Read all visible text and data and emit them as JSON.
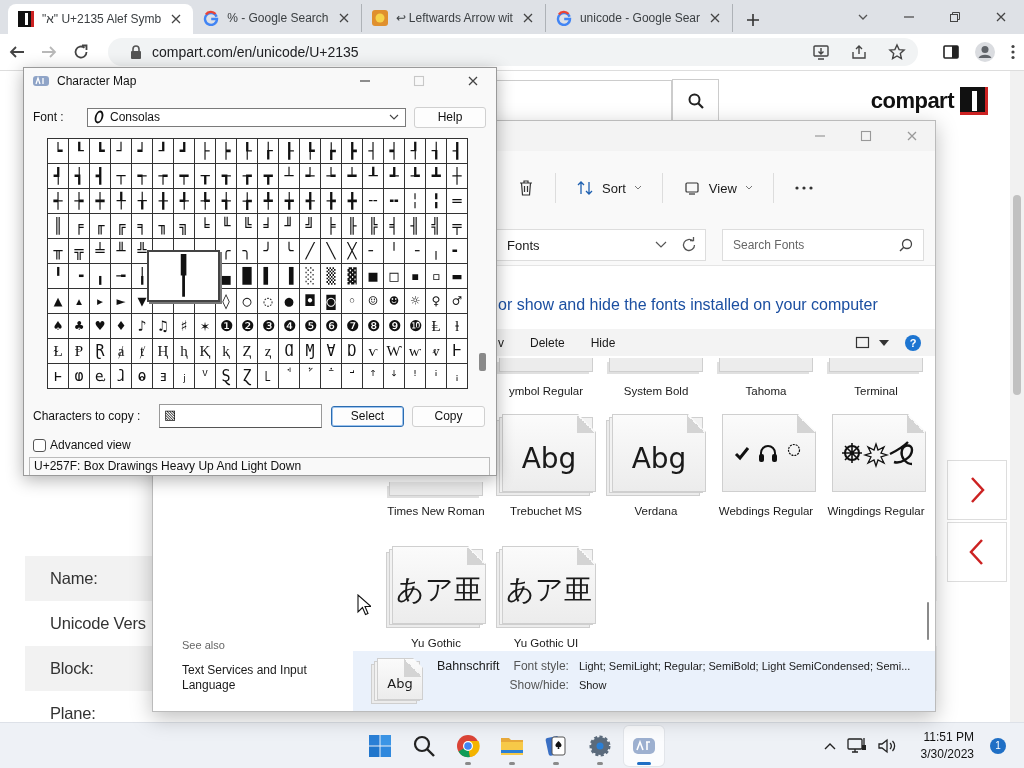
{
  "browser": {
    "tabs": [
      {
        "title": "\"א\" U+2135 Alef Symb",
        "kind": "logo",
        "selected": true
      },
      {
        "title": "% - Google Search",
        "kind": "g",
        "selected": false
      },
      {
        "title": "↩ Leftwards Arrow wit",
        "kind": "emoji",
        "selected": false
      },
      {
        "title": "unicode - Google Sear",
        "kind": "g",
        "selected": false
      }
    ],
    "forward": {
      "disabled": true
    },
    "address": "compart.com/en/unicode/U+2135"
  },
  "page": {
    "logo": "compart",
    "rows": [
      {
        "label": "Name:"
      },
      {
        "label": "Unicode Vers"
      },
      {
        "label": "Block:"
      },
      {
        "label": "Plane:"
      }
    ]
  },
  "charmap": {
    "title": "Character Map",
    "maximize": {
      "disabled": true
    },
    "font_label": "Font :",
    "font": "Consolas",
    "help": "Help",
    "grid": [
      [
        "┕",
        "┖",
        "┗",
        "┘",
        "┙",
        "┚",
        "┛",
        "├",
        "┝",
        "┞",
        "┟",
        "┠",
        "┡",
        "┢",
        "┣",
        "┤",
        "┥",
        "┦",
        "┧",
        "┨"
      ],
      [
        "┩",
        "┪",
        "┫",
        "┬",
        "┭",
        "┮",
        "┯",
        "┰",
        "┱",
        "┲",
        "┳",
        "┴",
        "┵",
        "┶",
        "┷",
        "┸",
        "┹",
        "┺",
        "┻",
        "┼"
      ],
      [
        "┽",
        "┾",
        "┿",
        "╀",
        "╁",
        "╂",
        "╃",
        "╄",
        "╅",
        "╆",
        "╇",
        "╈",
        "╉",
        "╊",
        "╋",
        "╌",
        "╍",
        "╎",
        "╏",
        "═"
      ],
      [
        "║",
        "╒",
        "╓",
        "╔",
        "╕",
        "╖",
        "╗",
        "╘",
        "╙",
        "╚",
        "╛",
        "╜",
        "╝",
        "╞",
        "╟",
        "╠",
        "╡",
        "╢",
        "╣",
        "╤"
      ],
      {
        "left": [
          "╥",
          "╦",
          "╧",
          "╨",
          "╩"
        ],
        "right": [
          "╭",
          "╮",
          "╯",
          "╰",
          "╱",
          "╲",
          "╳",
          "╴",
          "╵",
          "╶",
          "╷",
          "╸"
        ]
      },
      {
        "left": [
          "╹",
          "╺",
          "╻",
          "╼",
          "╽"
        ],
        "right": [
          "▄",
          "█",
          "▌",
          "▐",
          "░",
          "▒",
          "▓",
          "■",
          "□",
          "▪",
          "▫",
          "▬"
        ]
      },
      {
        "left": [
          "▲",
          "▴",
          "▸",
          "►",
          "▼"
        ],
        "right": [
          "◊",
          "○",
          "◌",
          "●",
          "◘",
          "◙",
          "◦",
          "☺",
          "☻",
          "☼",
          "♀",
          "♂"
        ]
      },
      [
        "♠",
        "♣",
        "♥",
        "♦",
        "♪",
        "♫",
        "♯",
        "✶",
        "❶",
        "❷",
        "❸",
        "❹",
        "❺",
        "❻",
        "❼",
        "❽",
        "❾",
        "❿",
        "Ⱡ",
        "ⱡ"
      ],
      [
        "Ɫ",
        "Ᵽ",
        "Ɽ",
        "ⱥ",
        "ⱦ",
        "Ⱨ",
        "ⱨ",
        "Ⱪ",
        "ⱪ",
        "Ⱬ",
        "ⱬ",
        "Ɑ",
        "Ɱ",
        "Ɐ",
        "Ɒ",
        "ⱱ",
        "Ⱳ",
        "ⱳ",
        "ⱴ",
        "Ⱶ"
      ],
      [
        "ⱶ",
        "ⱷ",
        "ⱸ",
        "ⱹ",
        "ⱺ",
        "ⱻ",
        "ⱼ",
        "ⱽ",
        "Ȿ",
        "Ɀ",
        "꜖",
        "ꜗ",
        "ꜘ",
        "ꜙ",
        "ꜚ",
        "ꜛ",
        "ꜜ",
        "ꜝ",
        "ꜞ",
        "ꜟ"
      ]
    ],
    "magnified": "╿",
    "copy_label": "Characters to copy :",
    "copy_value": "▧",
    "buttons": [
      {
        "label": "Select",
        "focused": true
      },
      {
        "label": "Copy",
        "focused": false
      }
    ],
    "advanced": {
      "label": "Advanced view",
      "checked": false
    },
    "status": "U+257F: Box Drawings Heavy Up And Light Down"
  },
  "fonts_window": {
    "toolbar": [
      {
        "kind": "delete"
      },
      {
        "kind": "sort",
        "label": "Sort"
      },
      {
        "kind": "view",
        "label": "View"
      },
      {
        "kind": "more"
      }
    ],
    "location": "Fonts",
    "search_placeholder": "Search Fonts",
    "heading": "or show and hide the fonts installed on your computer",
    "actions": [
      "v",
      "Delete",
      "Hide"
    ],
    "help": "?",
    "tile_rows": [
      [
        {
          "name": "ymbol Regular",
          "kind": "stub",
          "stacked": true
        },
        {
          "name": "System Bold",
          "kind": "stub",
          "stacked": true
        },
        {
          "name": "Tahoma",
          "kind": "stub",
          "stacked": true
        },
        {
          "name": "Terminal",
          "kind": "stub",
          "stacked": true
        }
      ],
      [
        {
          "name": "Times New Roman",
          "kind": "stub",
          "stacked": true
        },
        {
          "name": "Trebuchet MS",
          "kind": "text",
          "preview": "Abg",
          "stacked": true
        },
        {
          "name": "Verdana",
          "kind": "text",
          "preview": "Abg",
          "stacked": true
        },
        {
          "name": "Webdings Regular",
          "kind": "webdings",
          "stacked": false
        },
        {
          "name": "Wingdings Regular",
          "kind": "wingdings",
          "stacked": false
        }
      ],
      [
        {
          "name": "Yu Gothic",
          "kind": "text",
          "preview": "あア亜",
          "stacked": true
        },
        {
          "name": "Yu Gothic UI",
          "kind": "text",
          "preview": "あア亜",
          "stacked": true
        }
      ]
    ],
    "see_also": {
      "title": "See also",
      "links": [
        "Text Services and Input Language"
      ]
    },
    "details": {
      "preview": "Abg",
      "name": "Bahnschrift",
      "fields": [
        {
          "label": "Font style:",
          "value": "Light; SemiLight; Regular; SemiBold; Light SemiCondensed; Semi..."
        },
        {
          "label": "Show/hide:",
          "value": "Show"
        }
      ]
    }
  },
  "taskbar": {
    "apps": [
      {
        "kind": "start",
        "running": false,
        "selected": false
      },
      {
        "kind": "search",
        "running": false,
        "selected": false
      },
      {
        "kind": "browser",
        "running": true,
        "selected": false
      },
      {
        "kind": "files",
        "running": true,
        "selected": false
      },
      {
        "kind": "cards",
        "running": true,
        "selected": false
      },
      {
        "kind": "settings",
        "running": true,
        "selected": false
      },
      {
        "kind": "charmap",
        "running": true,
        "selected": true
      }
    ],
    "time": "11:51 PM",
    "date": "3/30/2023",
    "badge": "1"
  }
}
